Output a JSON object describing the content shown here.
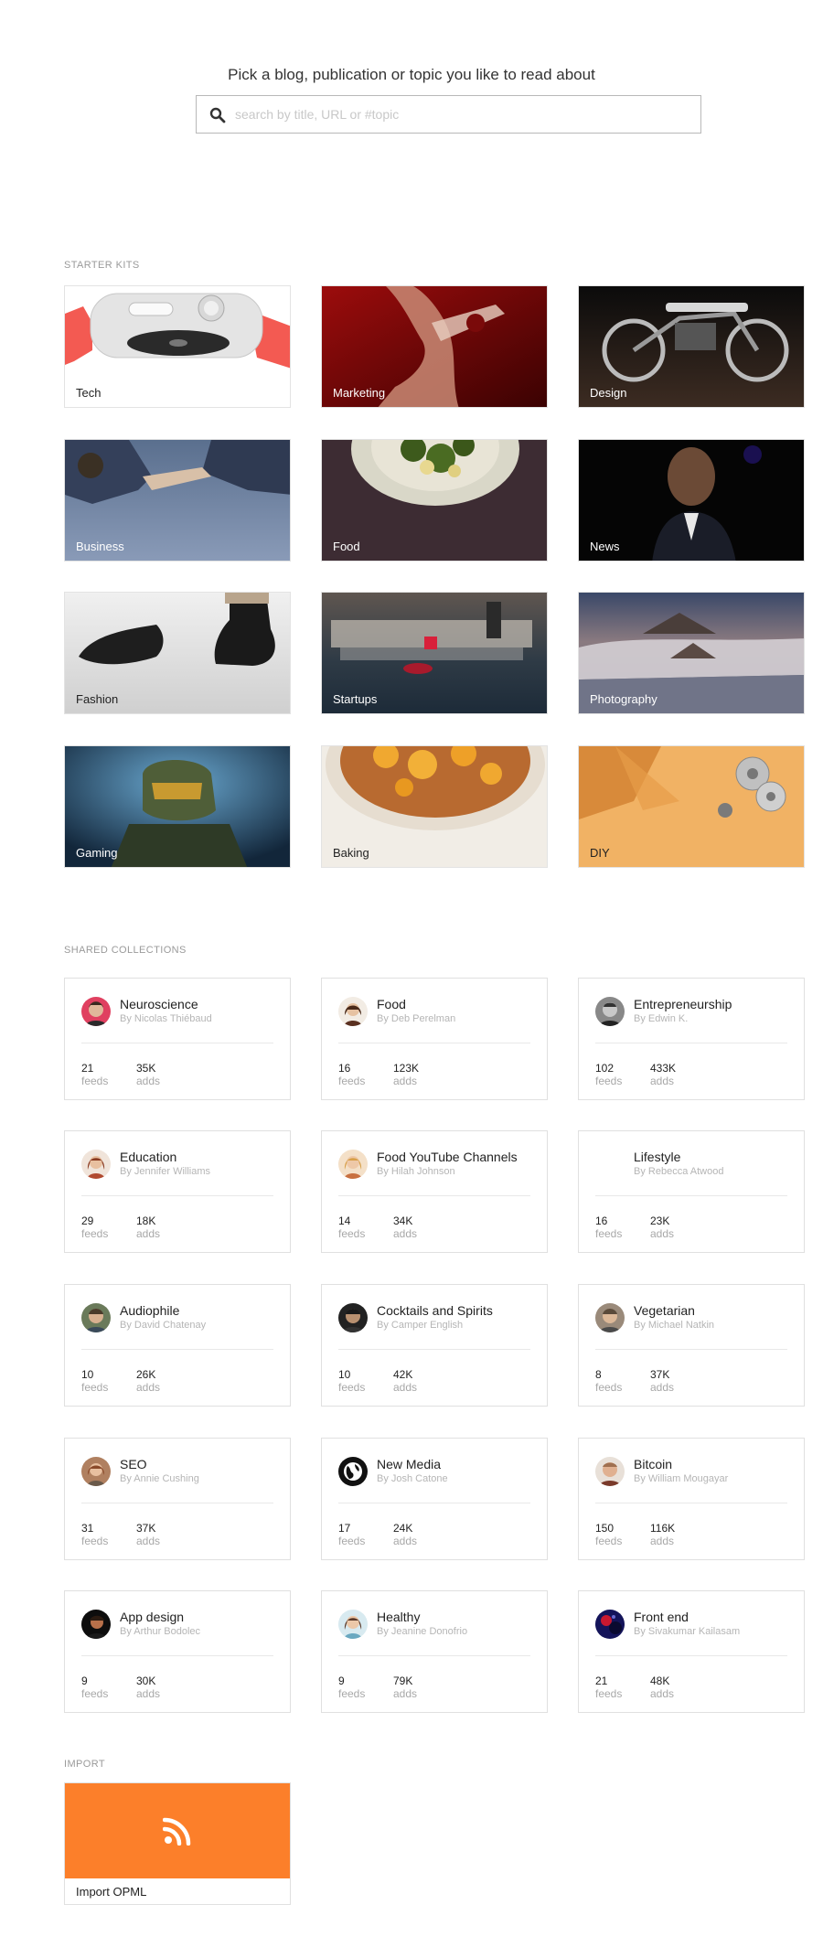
{
  "header": {
    "prompt": "Pick a blog, publication or topic you like to read about",
    "search_placeholder": "search by title, URL or #topic"
  },
  "starter_kits": {
    "label": "STARTER KITS",
    "items": [
      {
        "label": "Tech",
        "icon": "tech-image"
      },
      {
        "label": "Marketing",
        "icon": "marketing-image"
      },
      {
        "label": "Design",
        "icon": "design-image"
      },
      {
        "label": "Business",
        "icon": "business-image"
      },
      {
        "label": "Food",
        "icon": "food-image"
      },
      {
        "label": "News",
        "icon": "news-image"
      },
      {
        "label": "Fashion",
        "icon": "fashion-image"
      },
      {
        "label": "Startups",
        "icon": "startups-image"
      },
      {
        "label": "Photography",
        "icon": "photography-image"
      },
      {
        "label": "Gaming",
        "icon": "gaming-image"
      },
      {
        "label": "Baking",
        "icon": "baking-image"
      },
      {
        "label": "DIY",
        "icon": "diy-image"
      }
    ]
  },
  "shared_collections": {
    "label": "SHARED COLLECTIONS",
    "feeds_label": "feeds",
    "adds_label": "adds",
    "items": [
      {
        "title": "Neuroscience",
        "author": "By Nicolas Thiébaud",
        "feeds": "21",
        "adds": "35K"
      },
      {
        "title": "Food",
        "author": "By Deb Perelman",
        "feeds": "16",
        "adds": "123K"
      },
      {
        "title": "Entrepreneurship",
        "author": "By Edwin K.",
        "feeds": "102",
        "adds": "433K"
      },
      {
        "title": "Education",
        "author": "By Jennifer Williams",
        "feeds": "29",
        "adds": "18K"
      },
      {
        "title": "Food YouTube Channels",
        "author": "By Hilah Johnson",
        "feeds": "14",
        "adds": "34K"
      },
      {
        "title": "Lifestyle",
        "author": "By Rebecca Atwood",
        "feeds": "16",
        "adds": "23K"
      },
      {
        "title": "Audiophile",
        "author": "By David Chatenay",
        "feeds": "10",
        "adds": "26K"
      },
      {
        "title": "Cocktails and Spirits",
        "author": "By Camper English",
        "feeds": "10",
        "adds": "42K"
      },
      {
        "title": "Vegetarian",
        "author": "By Michael Natkin",
        "feeds": "8",
        "adds": "37K"
      },
      {
        "title": "SEO",
        "author": "By Annie Cushing",
        "feeds": "31",
        "adds": "37K"
      },
      {
        "title": "New Media",
        "author": "By Josh Catone",
        "feeds": "17",
        "adds": "24K"
      },
      {
        "title": "Bitcoin",
        "author": "By William Mougayar",
        "feeds": "150",
        "adds": "116K"
      },
      {
        "title": "App design",
        "author": "By Arthur Bodolec",
        "feeds": "9",
        "adds": "30K"
      },
      {
        "title": "Healthy",
        "author": "By Jeanine Donofrio",
        "feeds": "9",
        "adds": "79K"
      },
      {
        "title": "Front end",
        "author": "By Sivakumar Kailasam",
        "feeds": "21",
        "adds": "48K"
      }
    ]
  },
  "import": {
    "label": "IMPORT",
    "tile_label": "Import OPML",
    "icon": "rss-icon",
    "accent_color": "#fc7f2a"
  }
}
